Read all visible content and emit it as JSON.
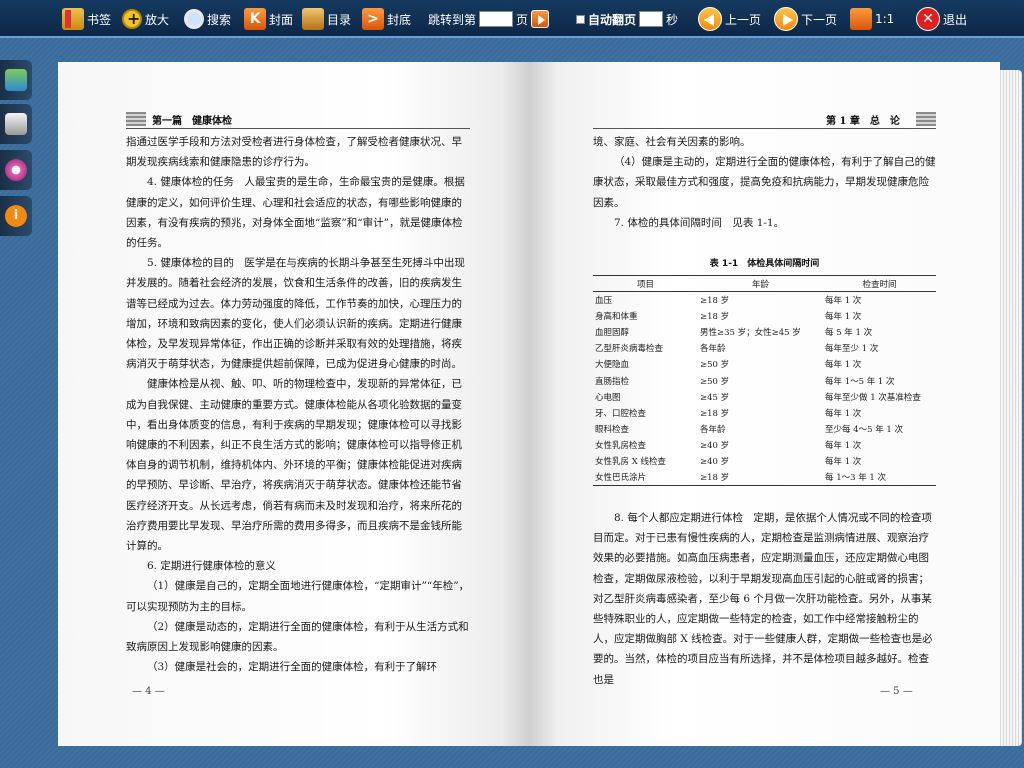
{
  "toolbar": {
    "bookmark": "书签",
    "zoom": "放大",
    "search": "搜索",
    "cover": "封面",
    "toc": "目录",
    "back_cover": "封底",
    "jump_prefix": "跳转到第",
    "jump_suffix": "页",
    "auto_flip": "自动翻页",
    "seconds": "秒",
    "prev": "上一页",
    "next": "下一页",
    "ratio": "1:1",
    "exit": "退出"
  },
  "left_page": {
    "header": "第一篇　健康体检",
    "page_number": "— 4 —",
    "paragraphs": [
      {
        "indent": false,
        "text": "指通过医学手段和方法对受检者进行身体检查，了解受检者健康状况、早期发现疾病线索和健康隐患的诊疗行为。"
      },
      {
        "indent": true,
        "text": "4. 健康体检的任务　人最宝贵的是生命，生命最宝贵的是健康。根据健康的定义，如何评价生理、心理和社会适应的状态，有哪些影响健康的因素，有没有疾病的预兆，对身体全面地“监察”和“审计”，就是健康体检的任务。"
      },
      {
        "indent": true,
        "text": "5. 健康体检的目的　医学是在与疾病的长期斗争甚至生死搏斗中出现并发展的。随着社会经济的发展，饮食和生活条件的改善，旧的疾病发生谱等已经成为过去。体力劳动强度的降低，工作节奏的加快，心理压力的增加，环境和致病因素的变化，使人们必须认识新的疾病。定期进行健康体检，及早发现异常体征，作出正确的诊断并采取有效的处理措施，将疾病消灭于萌芽状态，为健康提供超前保障，已成为促进身心健康的时尚。"
      },
      {
        "indent": true,
        "text": "健康体检是从视、触、叩、听的物理检查中，发现新的异常体征，已成为自我保健、主动健康的重要方式。健康体检能从各项化验数据的量变中，看出身体质变的信息，有利于疾病的早期发现；健康体检可以寻找影响健康的不利因素，纠正不良生活方式的影响；健康体检可以指导修正机体自身的调节机制，维持机体内、外环境的平衡；健康体检能促进对疾病的早预防、早诊断、早治疗，将疾病消灭于萌芽状态。健康体检还能节省医疗经济开支。从长远考虑，倘若有病而未及时发现和治疗，将来所花的治疗费用要比早发现、早治疗所需的费用多得多，而且疾病不是金钱所能计算的。"
      },
      {
        "indent": true,
        "text": "6. 定期进行健康体检的意义"
      },
      {
        "indent": true,
        "text": "（1）健康是自己的，定期全面地进行健康体检，“定期审计”“年检”，可以实现预防为主的目标。"
      },
      {
        "indent": true,
        "text": "（2）健康是动态的，定期进行全面的健康体检，有利于从生活方式和致病原因上发现影响健康的因素。"
      },
      {
        "indent": true,
        "text": "（3）健康是社会的，定期进行全面的健康体检，有利于了解环"
      }
    ]
  },
  "right_page": {
    "header": "第 1 章　总　论",
    "page_number": "— 5 —",
    "paragraphs_top": [
      {
        "indent": false,
        "text": "境、家庭、社会有关因素的影响。"
      },
      {
        "indent": true,
        "text": "（4）健康是主动的，定期进行全面的健康体检，有利于了解自己的健康状态，采取最佳方式和强度，提高免疫和抗病能力，早期发现健康危险因素。"
      },
      {
        "indent": true,
        "text": "7. 体检的具体间隔时间　见表 1-1。"
      }
    ],
    "table": {
      "caption": "表 1-1　体检具体间隔时间",
      "headers": [
        "项目",
        "年龄",
        "检查时间"
      ],
      "rows": [
        [
          "血压",
          "≥18 岁",
          "每年 1 次"
        ],
        [
          "身高和体重",
          "≥18 岁",
          "每年 1 次"
        ],
        [
          "血胆固醇",
          "男性≥35 岁；女性≥45 岁",
          "每 5 年 1 次"
        ],
        [
          "乙型肝炎病毒检查",
          "各年龄",
          "每年至少 1 次"
        ],
        [
          "大便隐血",
          "≥50 岁",
          "每年 1 次"
        ],
        [
          "直肠指检",
          "≥50 岁",
          "每年 1～5 年 1 次"
        ],
        [
          "心电图",
          "≥45 岁",
          "每年至少做 1 次基准检查"
        ],
        [
          "牙、口腔检查",
          "≥18 岁",
          "每年 1 次"
        ],
        [
          "眼科检查",
          "各年龄",
          "至少每 4～5 年 1 次"
        ],
        [
          "女性乳房检查",
          "≥40 岁",
          "每年 1 次"
        ],
        [
          "女性乳房 X 线检查",
          "≥40 岁",
          "每年 1 次"
        ],
        [
          "女性巴氏涂片",
          "≥18 岁",
          "每 1～3 年 1 次"
        ]
      ]
    },
    "paragraphs_bottom": [
      {
        "indent": true,
        "text": "8. 每个人都应定期进行体检　定期，是依据个人情况或不同的检查项目而定。对于已患有慢性疾病的人，定期检查是监测病情进展、观察治疗效果的必要措施。如高血压病患者，应定期测量血压，还应定期做心电图检查，定期做尿液检验，以利于早期发现高血压引起的心脏或肾的损害；对乙型肝炎病毒感染者，至少每 6 个月做一次肝功能检查。另外，从事某些特殊职业的人，应定期做一些特定的检查，如工作中经常接触粉尘的人，应定期做胸部 X 线检查。对于一些健康人群，定期做一些检查也是必要的。当然，体检的项目应当有所选择，并不是体检项目越多越好。检查也是"
      }
    ]
  }
}
